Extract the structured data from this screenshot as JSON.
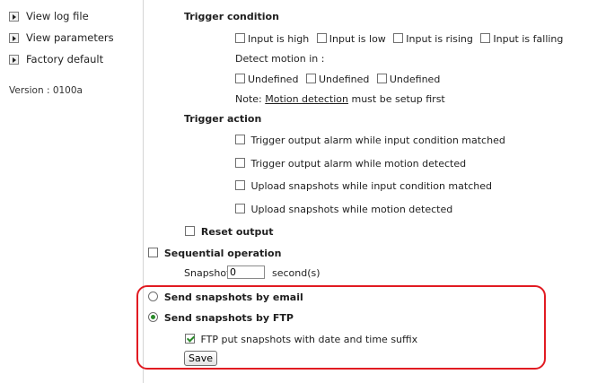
{
  "sidebar": {
    "items": [
      {
        "label": "View log file"
      },
      {
        "label": "View parameters"
      },
      {
        "label": "Factory default"
      }
    ],
    "version": "Version : 0100a"
  },
  "trigger_condition": {
    "heading": "Trigger condition",
    "options": [
      "Input is high",
      "Input is low",
      "Input is rising",
      "Input is falling"
    ],
    "detect_motion_label": "Detect motion in :",
    "motion_windows": [
      "Undefined",
      "Undefined",
      "Undefined"
    ],
    "note_prefix": "Note:",
    "note_link": "Motion detection",
    "note_suffix": "must be setup first"
  },
  "trigger_action": {
    "heading": "Trigger action",
    "options": [
      "Trigger output alarm while input condition matched",
      "Trigger output alarm while motion detected",
      "Upload snapshots while input condition matched",
      "Upload snapshots while motion detected"
    ],
    "reset_output": "Reset output"
  },
  "sequential": {
    "label": "Sequential operation",
    "snapshot_every": "Snapshot every",
    "value": "0",
    "unit": "second(s)"
  },
  "delivery": {
    "email_label": "Send snapshots by email",
    "ftp_label": "Send snapshots by FTP",
    "ftp_suffix_label": "FTP put snapshots with date and time suffix",
    "save_label": "Save"
  },
  "colors": {
    "highlight": "#e11b22",
    "check": "#2a8a2a"
  }
}
